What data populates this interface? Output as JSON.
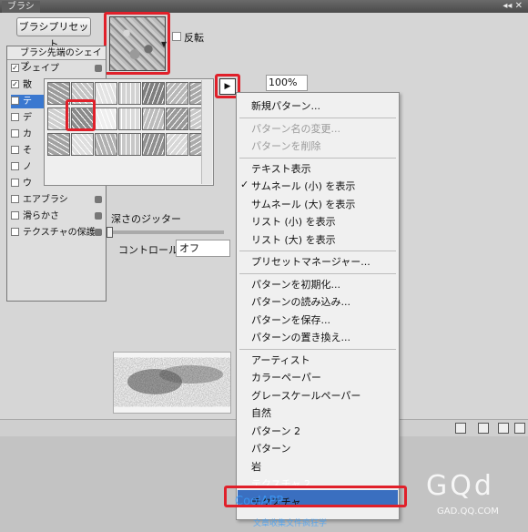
{
  "window": {
    "tab_label": "ブラシ",
    "controls": "◂◂ ✕"
  },
  "toolbar": {
    "preset_button": "ブラシプリセット",
    "invert_label": "反転"
  },
  "brush_list": {
    "header": "ブラシ先端のシェイプ",
    "items": [
      {
        "label": "シェイプ",
        "checked": true,
        "lock": true,
        "selected": false
      },
      {
        "label": "散",
        "checked": true,
        "lock": false,
        "selected": false
      },
      {
        "label": "テ",
        "checked": true,
        "lock": false,
        "selected": true
      },
      {
        "label": "デ",
        "checked": false,
        "lock": false,
        "selected": false
      },
      {
        "label": "カ",
        "checked": false,
        "lock": false,
        "selected": false
      },
      {
        "label": "そ",
        "checked": false,
        "lock": false,
        "selected": false
      },
      {
        "label": "ノ",
        "checked": false,
        "lock": false,
        "selected": false
      },
      {
        "label": "ウ",
        "checked": false,
        "lock": false,
        "selected": false
      },
      {
        "label": "エアブラシ",
        "checked": false,
        "lock": true,
        "selected": false
      },
      {
        "label": "滑らかさ",
        "checked": false,
        "lock": true,
        "selected": false
      },
      {
        "label": "テクスチャの保護",
        "checked": false,
        "lock": true,
        "selected": false
      }
    ]
  },
  "scale_value": "100%",
  "jitter_label": "深さのジッター",
  "control_label": "コントロール：",
  "control_value": "オフ",
  "popup_arrow": "▶",
  "menu": {
    "items": [
      {
        "label": "新規パターン...",
        "disabled": false
      },
      {
        "label": "パターン名の変更...",
        "disabled": true
      },
      {
        "label": "パターンを削除",
        "disabled": true
      },
      {
        "label": "テキスト表示",
        "disabled": false
      },
      {
        "label": "サムネール (小) を表示",
        "disabled": false,
        "checked": true
      },
      {
        "label": "サムネール (大) を表示",
        "disabled": false
      },
      {
        "label": "リスト (小) を表示",
        "disabled": false
      },
      {
        "label": "リスト (大) を表示",
        "disabled": false
      },
      {
        "label": "プリセットマネージャー...",
        "disabled": false
      },
      {
        "label": "パターンを初期化...",
        "disabled": false
      },
      {
        "label": "パターンの読み込み...",
        "disabled": false
      },
      {
        "label": "パターンを保存...",
        "disabled": false
      },
      {
        "label": "パターンの置き換え...",
        "disabled": false
      },
      {
        "label": "アーティスト",
        "disabled": false
      },
      {
        "label": "カラーペーパー",
        "disabled": false
      },
      {
        "label": "グレースケールペーパー",
        "disabled": false
      },
      {
        "label": "自然",
        "disabled": false
      },
      {
        "label": "パターン 2",
        "disabled": false
      },
      {
        "label": "パターン",
        "disabled": false
      },
      {
        "label": "岩",
        "disabled": false
      },
      {
        "label": "テクスチャ 2",
        "disabled": false,
        "highlighted": true
      },
      {
        "label": "テクスチャ",
        "disabled": false
      }
    ]
  },
  "watermark": {
    "logo": "GQd",
    "logo_url": "GAD.QQ.COM",
    "app": "CoolAPP",
    "app_sub": "文章收集文件疯狂学"
  },
  "colors": {
    "highlight": "#3a6fc0",
    "annotation_red": "#e0202a",
    "selected_row": "#3a78d0"
  }
}
